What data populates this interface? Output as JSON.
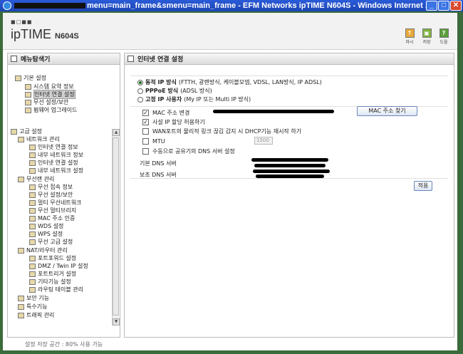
{
  "window": {
    "title": "menu=main_frame&smenu=main_frame - EFM Networks ipTIME N604S - Windows Internet ...",
    "buttons": {
      "minimize": "_",
      "maximize": "□",
      "close": "✕"
    }
  },
  "header": {
    "logo_text": "ipTIME",
    "logo_model": "N604S",
    "icons": [
      {
        "label": "마시",
        "icon": "arrow-up-icon",
        "color": "#e8a83a"
      },
      {
        "label": "저장",
        "icon": "save-icon",
        "color": "#7fb23e"
      },
      {
        "label": "도움",
        "icon": "help-icon",
        "color": "#5a9e3a"
      }
    ]
  },
  "menu": {
    "title": "메뉴탐색기",
    "basic": {
      "label": "기본 설정",
      "items": [
        "시스템 요약 정보",
        "인터넷 연결 설정",
        "무선 설정/보안",
        "펌웨어 업그레이드"
      ]
    },
    "advanced": {
      "label": "고급 설정",
      "groups": [
        {
          "label": "네트워크 관리",
          "items": [
            "인터넷 연결 정보",
            "내부 네트워크 정보",
            "인터넷 연결 설정",
            "내부 네트워크 설정"
          ]
        },
        {
          "label": "무선랜 관리",
          "items": [
            "무선 접속 정보",
            "무선 설정/보안",
            "멀티 무선네트워크",
            "무선 멀티브리지",
            "MAC 주소 인증",
            "WDS 설정",
            "WPS 설정",
            "무선 고급 설정"
          ]
        },
        {
          "label": "NAT/라우터 관리",
          "items": [
            "포트포워드 설정",
            "DMZ / Twin IP 설정",
            "포트트리거 설정",
            "기타기능 설정",
            "라우팅 테이블 관리"
          ]
        }
      ],
      "collapsed": [
        "보안 기능",
        "특수기능",
        "트래픽 관리"
      ]
    },
    "storage": "설정 저장 공간 : 80% 사용 가능"
  },
  "content": {
    "title": "인터넷 연결 설정",
    "radio_options": [
      {
        "bold": "동적 IP 방식",
        "desc": "(FTTH, 광랜방식, 케이블모뎀, VDSL, LAN방식, IP ADSL)",
        "checked": true
      },
      {
        "bold": "PPPoE 방식",
        "desc": "(ADSL 방식)",
        "checked": false
      },
      {
        "bold": "고정 IP 사용자",
        "desc": "(My IP 또는 Multi IP 방식)",
        "checked": false
      }
    ],
    "options": [
      {
        "label": "MAC 주소 변경",
        "checked": true
      },
      {
        "label": "사설 IP 할당 허용하기",
        "checked": true
      },
      {
        "label": "WAN포트의 물리적 링크 끊김 감지 시 DHCP기능 재시작 하기",
        "checked": false
      },
      {
        "label": "MTU",
        "checked": false
      },
      {
        "label": "수동으로 공유기의 DNS 서버 설정",
        "checked": false
      }
    ],
    "mac_button": "MAC 주소 찾기",
    "mtu_value": "1500",
    "dns": {
      "primary_label": "기본 DNS 서버",
      "secondary_label": "보조 DNS 서버"
    },
    "apply_button": "적용"
  }
}
